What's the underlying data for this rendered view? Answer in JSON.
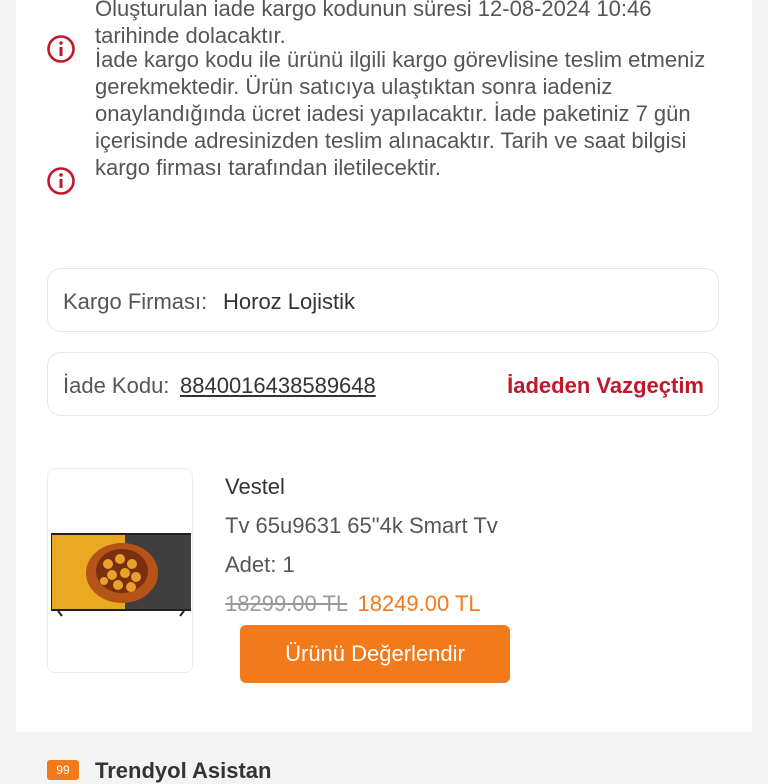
{
  "notices": [
    {
      "icon": "info-icon",
      "text": "Oluşturulan iade kargo kodunun süresi 12-08-2024 10:46 tarihinde dolacaktır."
    },
    {
      "icon": "info-icon",
      "text": "İade kargo kodu ile ürünü ilgili kargo görevlisine teslim etmeniz gerekmektedir. Ürün satıcıya ulaştıktan sonra iadeniz onaylandığında ücret iadesi yapılacaktır. İade paketiniz 7 gün içerisinde adresinizden teslim alınacaktır. Tarih ve saat bilgisi kargo firması tarafından iletilecektir."
    }
  ],
  "cargo": {
    "label": "Kargo Firması:",
    "value": "Horoz Lojistik"
  },
  "return_code": {
    "label": "İade Kodu:",
    "value": "8840016438589648",
    "cancel_label": "İadeden Vazgeçtim"
  },
  "product": {
    "brand": "Vestel",
    "name": "Tv 65u9631 65\"4k Smart Tv",
    "quantity": "Adet: 1",
    "old_price": "18299.00 TL",
    "price": "18249.00 TL",
    "review_button": "Ürünü Değerlendir"
  },
  "assistant": {
    "badge": "99",
    "title": "Trendyol Asistan"
  },
  "colors": {
    "accent": "#f27a1a",
    "alert": "#c0182a"
  }
}
